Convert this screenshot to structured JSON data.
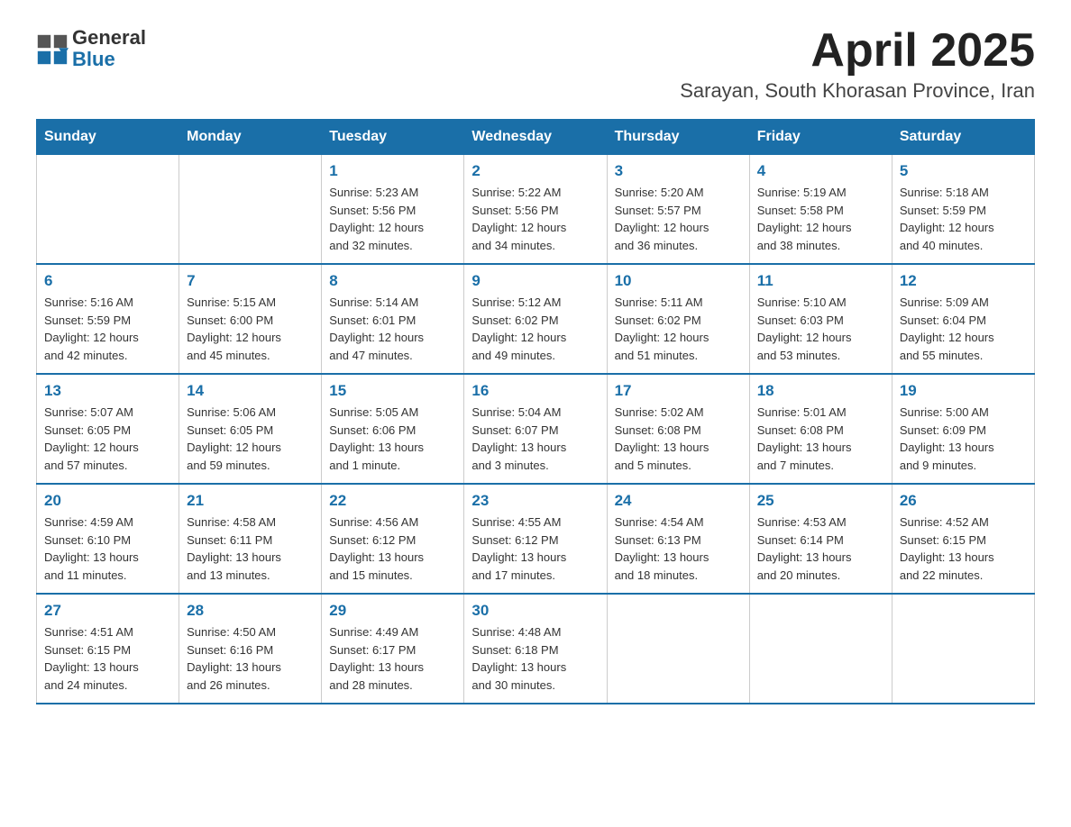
{
  "header": {
    "title": "April 2025",
    "subtitle": "Sarayan, South Khorasan Province, Iran",
    "logo_general": "General",
    "logo_blue": "Blue"
  },
  "days_of_week": [
    "Sunday",
    "Monday",
    "Tuesday",
    "Wednesday",
    "Thursday",
    "Friday",
    "Saturday"
  ],
  "weeks": [
    [
      {
        "day": "",
        "info": ""
      },
      {
        "day": "",
        "info": ""
      },
      {
        "day": "1",
        "info": "Sunrise: 5:23 AM\nSunset: 5:56 PM\nDaylight: 12 hours\nand 32 minutes."
      },
      {
        "day": "2",
        "info": "Sunrise: 5:22 AM\nSunset: 5:56 PM\nDaylight: 12 hours\nand 34 minutes."
      },
      {
        "day": "3",
        "info": "Sunrise: 5:20 AM\nSunset: 5:57 PM\nDaylight: 12 hours\nand 36 minutes."
      },
      {
        "day": "4",
        "info": "Sunrise: 5:19 AM\nSunset: 5:58 PM\nDaylight: 12 hours\nand 38 minutes."
      },
      {
        "day": "5",
        "info": "Sunrise: 5:18 AM\nSunset: 5:59 PM\nDaylight: 12 hours\nand 40 minutes."
      }
    ],
    [
      {
        "day": "6",
        "info": "Sunrise: 5:16 AM\nSunset: 5:59 PM\nDaylight: 12 hours\nand 42 minutes."
      },
      {
        "day": "7",
        "info": "Sunrise: 5:15 AM\nSunset: 6:00 PM\nDaylight: 12 hours\nand 45 minutes."
      },
      {
        "day": "8",
        "info": "Sunrise: 5:14 AM\nSunset: 6:01 PM\nDaylight: 12 hours\nand 47 minutes."
      },
      {
        "day": "9",
        "info": "Sunrise: 5:12 AM\nSunset: 6:02 PM\nDaylight: 12 hours\nand 49 minutes."
      },
      {
        "day": "10",
        "info": "Sunrise: 5:11 AM\nSunset: 6:02 PM\nDaylight: 12 hours\nand 51 minutes."
      },
      {
        "day": "11",
        "info": "Sunrise: 5:10 AM\nSunset: 6:03 PM\nDaylight: 12 hours\nand 53 minutes."
      },
      {
        "day": "12",
        "info": "Sunrise: 5:09 AM\nSunset: 6:04 PM\nDaylight: 12 hours\nand 55 minutes."
      }
    ],
    [
      {
        "day": "13",
        "info": "Sunrise: 5:07 AM\nSunset: 6:05 PM\nDaylight: 12 hours\nand 57 minutes."
      },
      {
        "day": "14",
        "info": "Sunrise: 5:06 AM\nSunset: 6:05 PM\nDaylight: 12 hours\nand 59 minutes."
      },
      {
        "day": "15",
        "info": "Sunrise: 5:05 AM\nSunset: 6:06 PM\nDaylight: 13 hours\nand 1 minute."
      },
      {
        "day": "16",
        "info": "Sunrise: 5:04 AM\nSunset: 6:07 PM\nDaylight: 13 hours\nand 3 minutes."
      },
      {
        "day": "17",
        "info": "Sunrise: 5:02 AM\nSunset: 6:08 PM\nDaylight: 13 hours\nand 5 minutes."
      },
      {
        "day": "18",
        "info": "Sunrise: 5:01 AM\nSunset: 6:08 PM\nDaylight: 13 hours\nand 7 minutes."
      },
      {
        "day": "19",
        "info": "Sunrise: 5:00 AM\nSunset: 6:09 PM\nDaylight: 13 hours\nand 9 minutes."
      }
    ],
    [
      {
        "day": "20",
        "info": "Sunrise: 4:59 AM\nSunset: 6:10 PM\nDaylight: 13 hours\nand 11 minutes."
      },
      {
        "day": "21",
        "info": "Sunrise: 4:58 AM\nSunset: 6:11 PM\nDaylight: 13 hours\nand 13 minutes."
      },
      {
        "day": "22",
        "info": "Sunrise: 4:56 AM\nSunset: 6:12 PM\nDaylight: 13 hours\nand 15 minutes."
      },
      {
        "day": "23",
        "info": "Sunrise: 4:55 AM\nSunset: 6:12 PM\nDaylight: 13 hours\nand 17 minutes."
      },
      {
        "day": "24",
        "info": "Sunrise: 4:54 AM\nSunset: 6:13 PM\nDaylight: 13 hours\nand 18 minutes."
      },
      {
        "day": "25",
        "info": "Sunrise: 4:53 AM\nSunset: 6:14 PM\nDaylight: 13 hours\nand 20 minutes."
      },
      {
        "day": "26",
        "info": "Sunrise: 4:52 AM\nSunset: 6:15 PM\nDaylight: 13 hours\nand 22 minutes."
      }
    ],
    [
      {
        "day": "27",
        "info": "Sunrise: 4:51 AM\nSunset: 6:15 PM\nDaylight: 13 hours\nand 24 minutes."
      },
      {
        "day": "28",
        "info": "Sunrise: 4:50 AM\nSunset: 6:16 PM\nDaylight: 13 hours\nand 26 minutes."
      },
      {
        "day": "29",
        "info": "Sunrise: 4:49 AM\nSunset: 6:17 PM\nDaylight: 13 hours\nand 28 minutes."
      },
      {
        "day": "30",
        "info": "Sunrise: 4:48 AM\nSunset: 6:18 PM\nDaylight: 13 hours\nand 30 minutes."
      },
      {
        "day": "",
        "info": ""
      },
      {
        "day": "",
        "info": ""
      },
      {
        "day": "",
        "info": ""
      }
    ]
  ]
}
